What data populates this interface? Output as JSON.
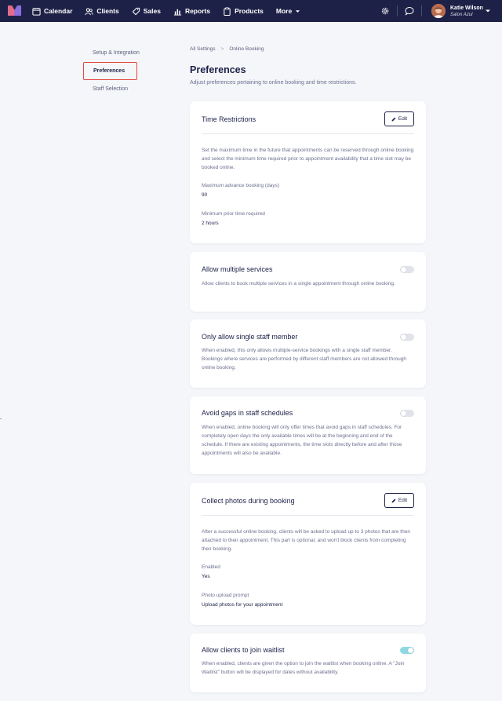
{
  "topbar": {
    "nav": [
      {
        "label": "Calendar",
        "icon": "calendar-icon"
      },
      {
        "label": "Clients",
        "icon": "users-icon"
      },
      {
        "label": "Sales",
        "icon": "tag-icon"
      },
      {
        "label": "Reports",
        "icon": "chart-icon"
      },
      {
        "label": "Products",
        "icon": "clipboard-icon"
      },
      {
        "label": "More",
        "icon": "chevron-down-icon"
      }
    ],
    "user": {
      "name": "Katie Wilson",
      "salon": "Salon Azul"
    }
  },
  "subnav": {
    "items": [
      {
        "label": "Setup & Integration"
      },
      {
        "label": "Preferences",
        "active": true
      },
      {
        "label": "Staff Selection"
      }
    ]
  },
  "breadcrumb": {
    "root": "All Settings",
    "sep": ">",
    "current": "Online Booking"
  },
  "page": {
    "title": "Preferences",
    "subtitle": "Adjust preferences pertaining to online booking and time restrictions."
  },
  "cards": {
    "time": {
      "title": "Time Restrictions",
      "edit_label": "Edit",
      "desc": "Set the maximum time in the future that appointments can be reserved through online booking and select the minimum time required prior to appointment availability that a time slot may be booked online.",
      "f1_label": "Maximum advance booking (days)",
      "f1_value": "90",
      "f2_label": "Minimum prior time required",
      "f2_value": "2 hours"
    },
    "multi": {
      "title": "Allow multiple services",
      "desc": "Allow clients to book multiple services in a single appointment through online booking.",
      "enabled": false
    },
    "single": {
      "title": "Only allow single staff member",
      "desc": "When enabled, this only allows multiple-service bookings with a single staff member. Bookings where services are performed by different staff members are not allowed through online booking.",
      "enabled": false
    },
    "gaps": {
      "title": "Avoid gaps in staff schedules",
      "desc": "When enabled, online booking will only offer times that avoid gaps in staff schedules. For completely open days the only available times will be at the beginning and end of the schedule. If there are existing appointments, the time slots directly before and after those appointments will also be available.",
      "enabled": false
    },
    "photos": {
      "title": "Collect photos during booking",
      "edit_label": "Edit",
      "desc": "After a successful online booking, clients will be asked to upload up to 3 photos that are then attached to their appointment. This part is optional, and won't block clients from completing their booking.",
      "f1_label": "Enabled",
      "f1_value": "Yes",
      "f2_label": "Photo upload prompt",
      "f2_value": "Upload photos for your appointment"
    },
    "waitlist": {
      "title": "Allow clients to join waitlist",
      "desc": "When enabled, clients are given the option to join the waitlist when booking online. A \"Join Waitlist\" button will be displayed for dates without availability.",
      "enabled": true
    }
  },
  "colors": {
    "nav_bg": "#1e2147",
    "accent_toggle": "#8fd8e0",
    "active_outline": "#e0463f"
  }
}
